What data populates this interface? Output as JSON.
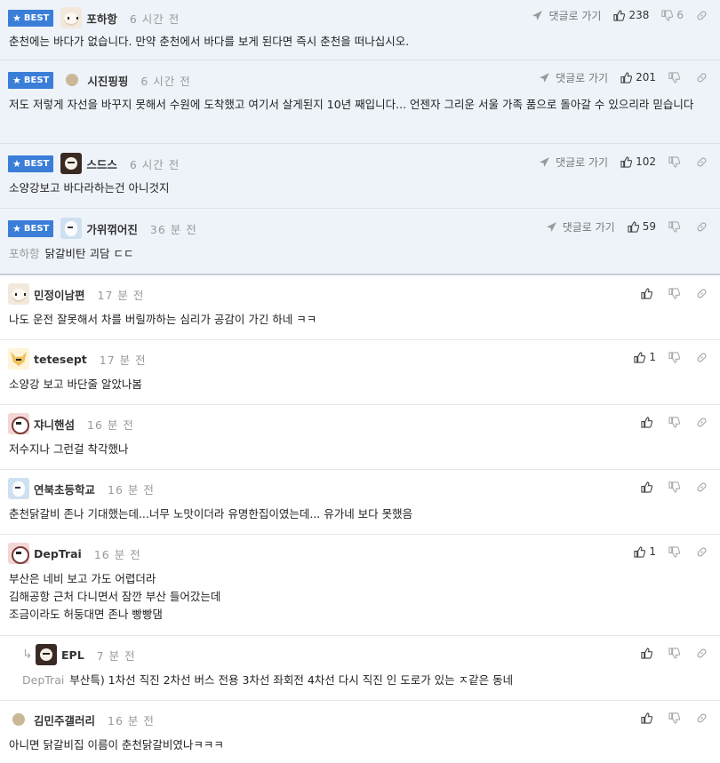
{
  "labels": {
    "best": "BEST",
    "reply_to": "댓글로 가기"
  },
  "best_comments": [
    {
      "nick": "포하항",
      "time": "6 시간 전",
      "text": "춘천에는 바다가 없습니다. 만약 춘천에서 바다를 보게 된다면 즉시 춘천을 떠나십시오.",
      "up": "238",
      "down": "6",
      "avatar": "dog1"
    },
    {
      "nick": "시진핑핑",
      "time": "6 시간 전",
      "text": "저도 저렇게 자선을 바꾸지 못해서 수원에 도착했고 여기서 살게된지 10년 째입니다... 언젠자 그리운 서울 가족 품으로 돌아갈 수 있으리라 믿습니다",
      "up": "201",
      "down": "",
      "avatar": "dot"
    },
    {
      "nick": "스드스",
      "time": "6 시간 전",
      "text": "소양강보고 바다라하는건 아니것지",
      "up": "102",
      "down": "",
      "avatar": "dark"
    },
    {
      "nick": "가위꺾어진",
      "time": "36 분 전",
      "mention": "포하항",
      "text": "닭갈비탄 괴담 ㄷㄷ",
      "up": "59",
      "down": "",
      "avatar": "blue"
    }
  ],
  "comments": [
    {
      "nick": "민정이남편",
      "time": "17 분 전",
      "text": "나도 운전 잘못해서 차를 버릴까하는 심리가 공감이 가긴 하네 ㅋㅋ",
      "up": "",
      "avatar": "dog1"
    },
    {
      "nick": "tetesept",
      "time": "17 분 전",
      "text": "소양강 보고 바단줄 알았나봄",
      "up": "1",
      "avatar": "fox"
    },
    {
      "nick": "쟈니핸섬",
      "time": "16 분 전",
      "text": "저수지나 그런걸 착각했나",
      "up": "",
      "avatar": "pink"
    },
    {
      "nick": "연북초등학교",
      "time": "16 분 전",
      "text": "춘천닭갈비 존나 기대했는데...너무 노맛이더라 유명한집이였는데... 유가네 보다 못했음",
      "up": "",
      "avatar": "blue"
    },
    {
      "nick": "DepTrai",
      "time": "16 분 전",
      "text": "부산은 네비 보고 가도 어렵더라\n김해공항 근처 다니면서 잠깐 부산 들어갔는데\n조금이라도 허둥대면 존나 빵빵댐",
      "up": "1",
      "avatar": "pink"
    },
    {
      "nick": "EPL",
      "time": "7 분 전",
      "mention": "DepTrai",
      "text": "부산특) 1차선 직진 2차선 버스 전용 3차선 좌회전 4차선 다시 직진 인 도로가 있는 ㅈ같은 동네",
      "up": "",
      "avatar": "dark",
      "is_reply": true
    },
    {
      "nick": "김민주갤러리",
      "time": "16 분 전",
      "text": "아니면 닭갈비집 이름이 춘천닭갈비였나ㅋㅋㅋ",
      "up": "",
      "avatar": "dot"
    }
  ],
  "colors": {
    "accent": "#3a7ed8",
    "best_bg": "#eef3fa"
  },
  "icons": [
    "star-icon",
    "send-icon",
    "thumb-up-icon",
    "thumb-down-icon",
    "link-icon",
    "reply-arrow-icon"
  ]
}
